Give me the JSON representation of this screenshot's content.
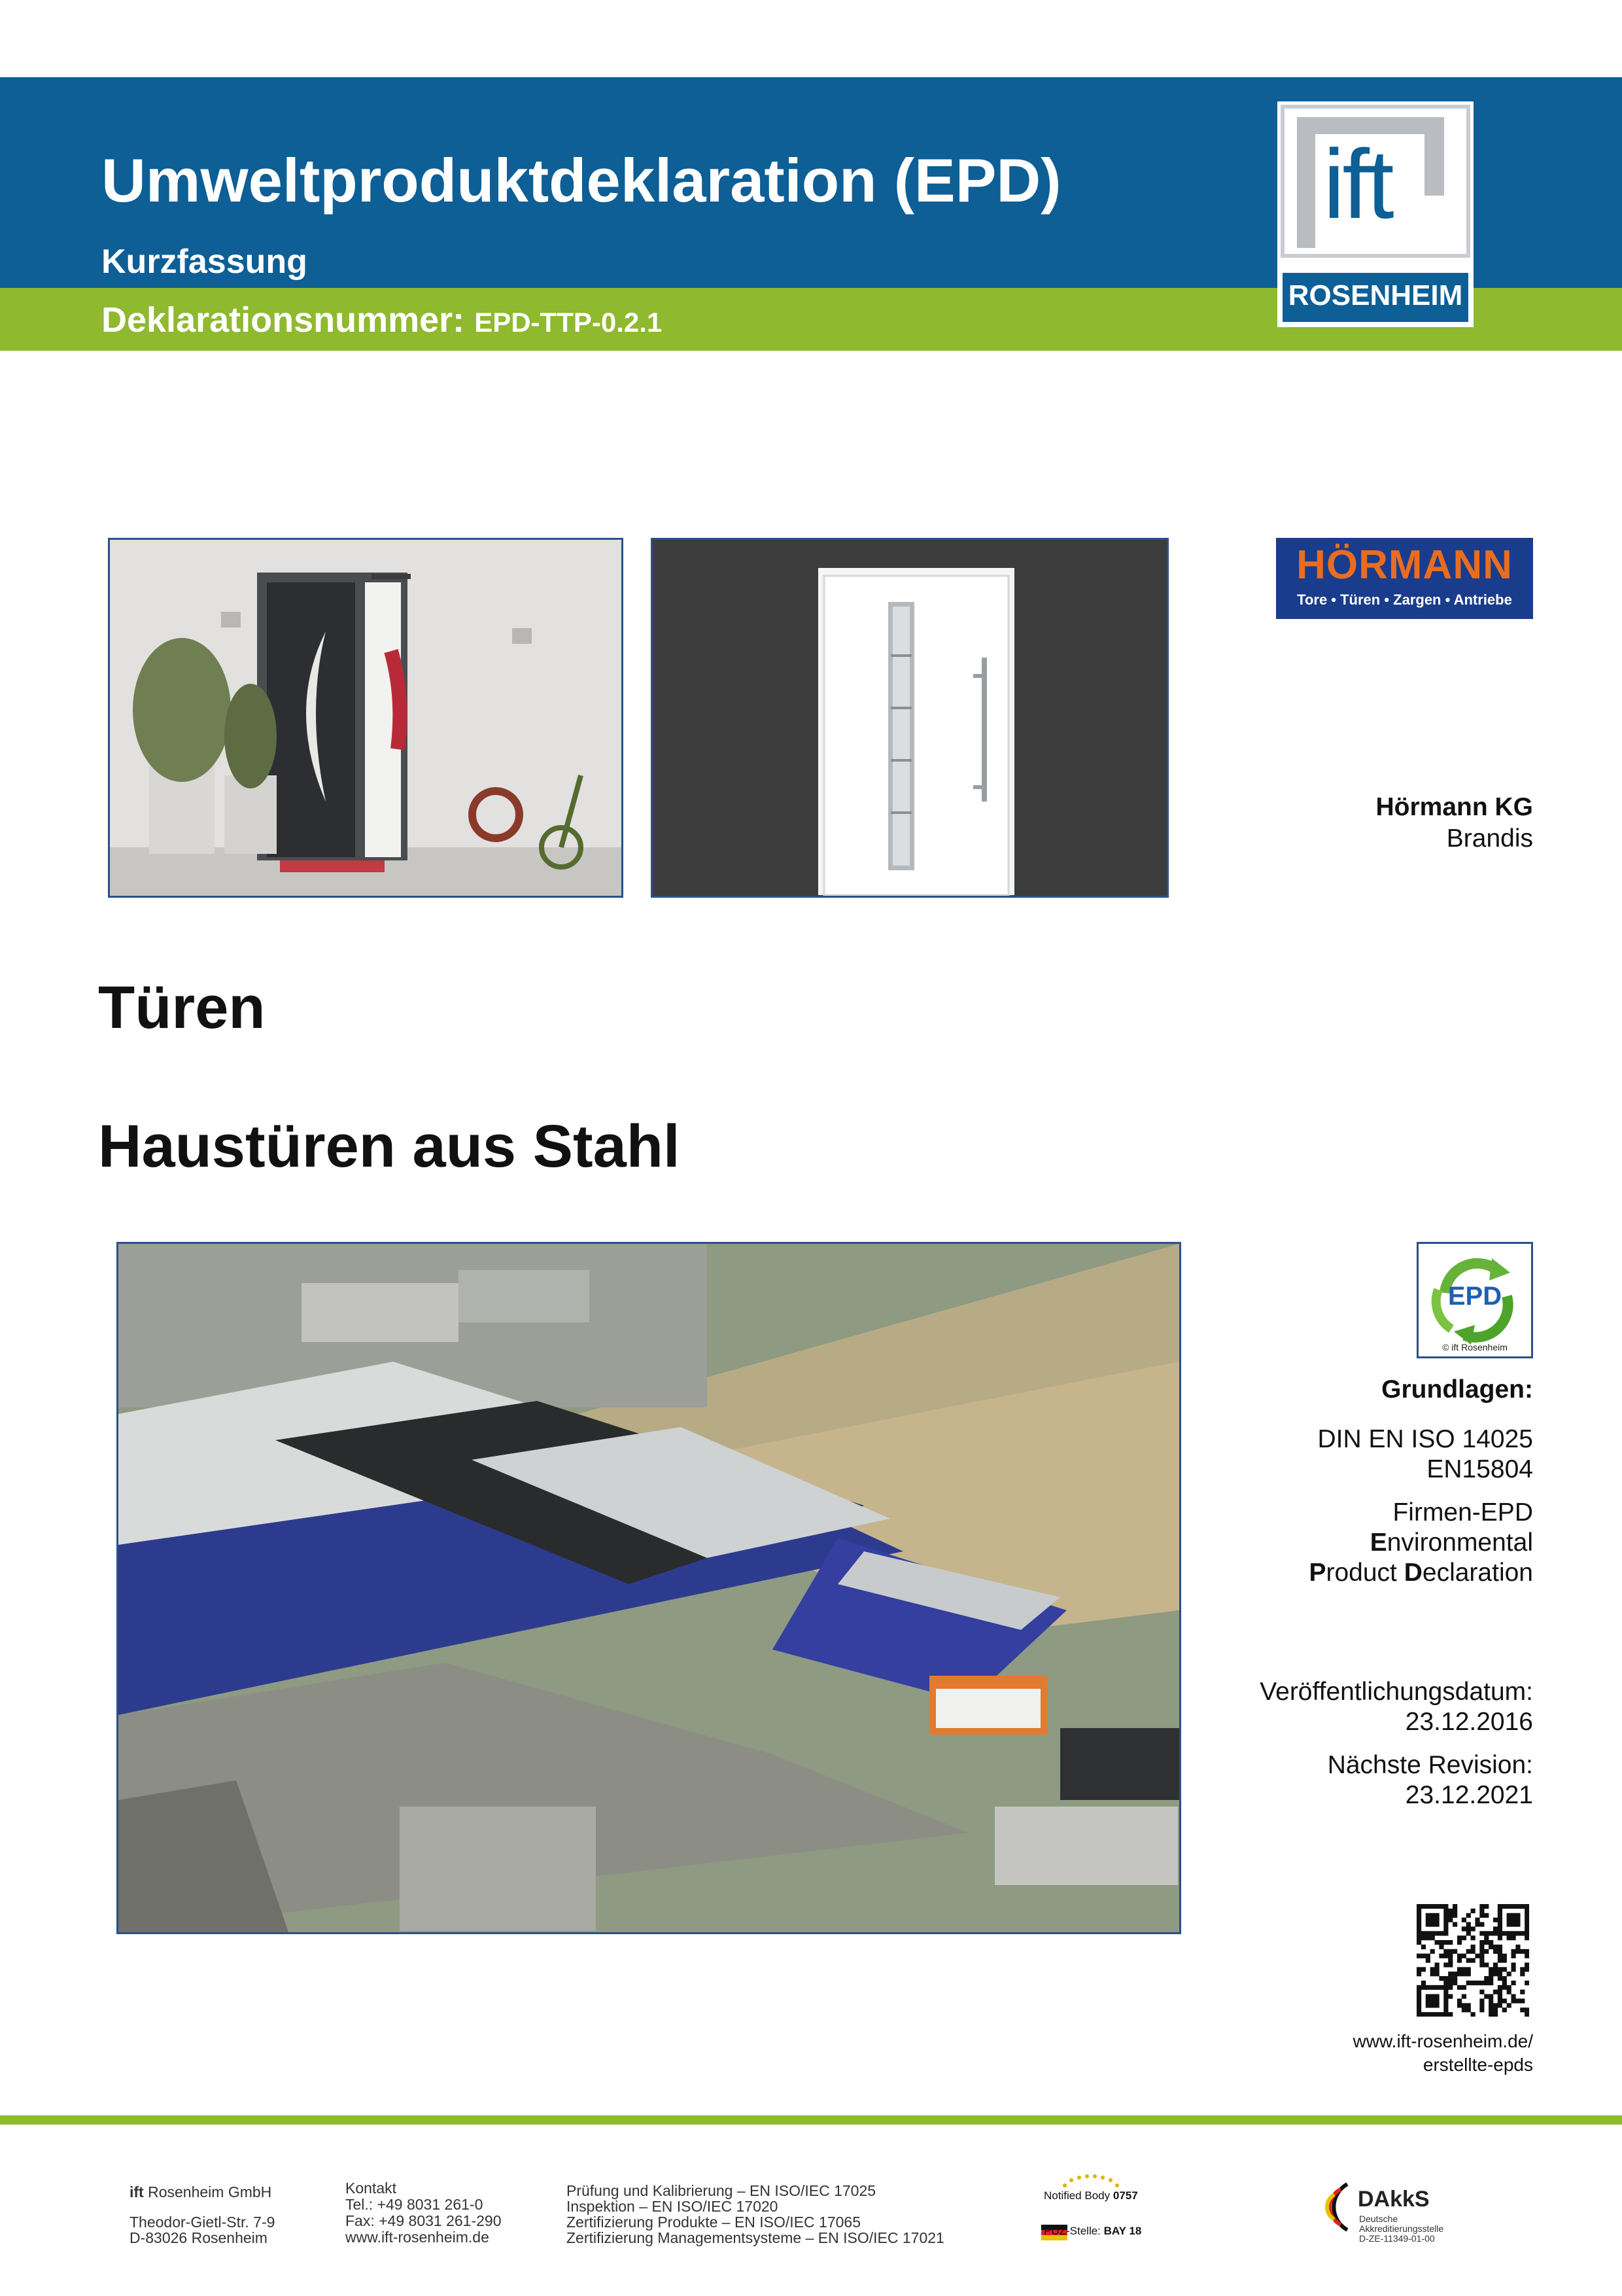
{
  "header": {
    "title": "Umweltproduktdeklaration (EPD)",
    "subtitle": "Kurzfassung",
    "decl_label": "Deklarationsnummer:",
    "decl_value": "EPD-TTP-0.2.1"
  },
  "ift_logo": {
    "big": "ift",
    "small": "ROSENHEIM"
  },
  "brand": {
    "name": "HÖRMANN",
    "tagline": "Tore • Türen • Zargen • Antriebe"
  },
  "company": {
    "name": "Hörmann KG",
    "city": "Brandis"
  },
  "product": {
    "category": "Türen",
    "name": "Haustüren aus Stahl"
  },
  "epd_badge": {
    "label": "EPD",
    "credit": "© ift Rosenheim"
  },
  "basis": {
    "heading": "Grundlagen:",
    "norm1": "DIN EN ISO 14025",
    "norm2": "EN15804",
    "type": "Firmen-EPD",
    "env_first": "E",
    "env_rest": "nvironmental",
    "prod_first": "P",
    "prod_mid": "roduct ",
    "decl_first": "D",
    "decl_rest": "eclaration"
  },
  "dates": {
    "pub_label": "Veröffentlichungsdatum:",
    "pub_date": "23.12.2016",
    "rev_label": "Nächste Revision:",
    "rev_date": "23.12.2021"
  },
  "link": {
    "line1": "www.ift-rosenheim.de/",
    "line2": "erstellte-epds"
  },
  "footer": {
    "company_bold": "ift",
    "company_rest": " Rosenheim GmbH",
    "street": "Theodor-Gietl-Str. 7-9",
    "zip_city": "D-83026 Rosenheim",
    "contact_title": "Kontakt",
    "tel": "Tel.: +49 8031 261-0",
    "fax": "Fax: +49 8031 261-290",
    "web": "www.ift-rosenheim.de",
    "cert1": "Prüfung und Kalibrierung – EN ISO/IEC 17025",
    "cert2": "Inspektion – EN ISO/IEC 17020",
    "cert3": "Zertifizierung Produkte – EN ISO/IEC 17065",
    "cert4": "Zertifizierung Managementsysteme – EN ISO/IEC 17021",
    "nb_label": "Notified Body",
    "nb_num": "0757",
    "puz_label": "PÜZ-Stelle:",
    "puz_num": "BAY 18",
    "dakks": "DAkkS",
    "dakks_1": "Deutsche",
    "dakks_2": "Akkreditierungsstelle",
    "dakks_3": "D-ZE-11349-01-00"
  },
  "colors": {
    "blue": "#0d5f96",
    "green": "#8fb92f",
    "hormann_blue": "#1a3c8c",
    "hormann_orange": "#e96d1f"
  }
}
